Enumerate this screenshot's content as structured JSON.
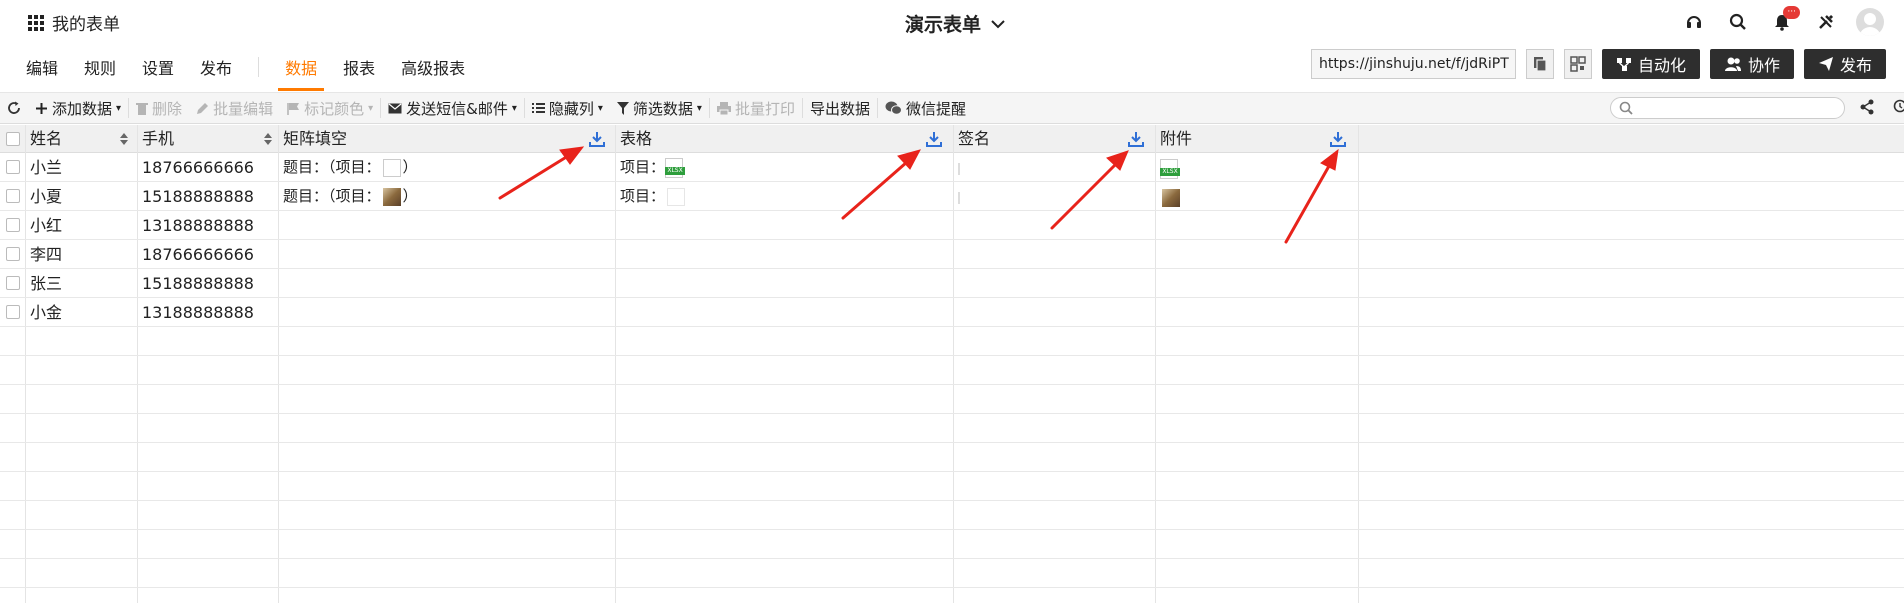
{
  "topbar": {
    "brand": "我的表单",
    "form_title": "演示表单",
    "notification_badge": "···"
  },
  "nav": {
    "items": [
      "编辑",
      "规则",
      "设置",
      "发布"
    ],
    "tabs": [
      "数据",
      "报表",
      "高级报表"
    ],
    "url": "https://jinshuju.net/f/jdRiPT",
    "automation": "自动化",
    "collaborate": "协作",
    "publish": "发布"
  },
  "toolbar": {
    "add_data": "添加数据",
    "delete": "删除",
    "bulk_edit": "批量编辑",
    "mark_color": "标记颜色",
    "send_sms_email": "发送短信&邮件",
    "hide_columns": "隐藏列",
    "filter_data": "筛选数据",
    "bulk_print": "批量打印",
    "export_data": "导出数据",
    "wechat_remind": "微信提醒",
    "search_placeholder": ""
  },
  "table": {
    "columns": [
      "姓名",
      "手机",
      "矩阵填空",
      "表格",
      "签名",
      "附件"
    ],
    "rows": [
      {
        "name": "小兰",
        "phone": "18766666666",
        "matrix_prefix": "题目：（项目：",
        "matrix_suffix": "）",
        "table_prefix": "项目："
      },
      {
        "name": "小夏",
        "phone": "15188888888",
        "matrix_prefix": "题目：（项目：",
        "matrix_suffix": "）",
        "table_prefix": "项目："
      },
      {
        "name": "小红",
        "phone": "13188888888"
      },
      {
        "name": "李四",
        "phone": "18766666666"
      },
      {
        "name": "张三",
        "phone": "15188888888"
      },
      {
        "name": "小金",
        "phone": "13188888888"
      }
    ],
    "xlsx_label": "XLSX"
  },
  "colors": {
    "accent": "#ff7a00",
    "dark_button": "#2e2e2e",
    "arrow": "#e8231b",
    "download": "#2f6fd6"
  }
}
